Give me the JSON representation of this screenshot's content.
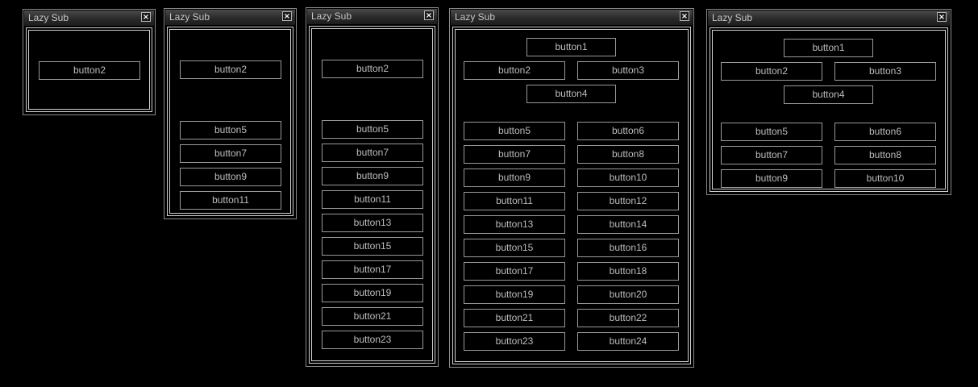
{
  "windows": [
    {
      "title": "Lazy Sub",
      "close_glyph": "×",
      "buttons": [
        "button2"
      ]
    },
    {
      "title": "Lazy Sub",
      "close_glyph": "×",
      "buttons": [
        "button2",
        "button5",
        "button7",
        "button9",
        "button11"
      ]
    },
    {
      "title": "Lazy Sub",
      "close_glyph": "×",
      "buttons": [
        "button2",
        "button5",
        "button7",
        "button9",
        "button11",
        "button13",
        "button15",
        "button17",
        "button19",
        "button21",
        "button23"
      ]
    },
    {
      "title": "Lazy Sub",
      "close_glyph": "×",
      "buttons": [
        "button1",
        "button2",
        "button3",
        "button4",
        "button5",
        "button6",
        "button7",
        "button8",
        "button9",
        "button10",
        "button11",
        "button12",
        "button13",
        "button14",
        "button15",
        "button16",
        "button17",
        "button18",
        "button19",
        "button20",
        "button21",
        "button22",
        "button23",
        "button24"
      ]
    },
    {
      "title": "Lazy Sub",
      "close_glyph": "×",
      "buttons": [
        "button1",
        "button2",
        "button3",
        "button4",
        "button5",
        "button6",
        "button7",
        "button8",
        "button9",
        "button10"
      ]
    }
  ]
}
